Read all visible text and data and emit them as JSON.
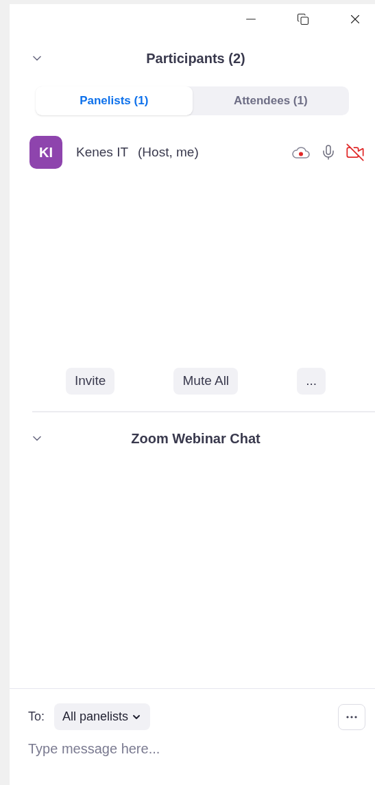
{
  "participants": {
    "title": "Participants (2)",
    "expanded": true,
    "tabs": [
      {
        "label": "Panelists (1)",
        "selected": true
      },
      {
        "label": "Attendees (1)",
        "selected": false
      }
    ],
    "list": [
      {
        "initials": "KI",
        "color": "#8e44ad",
        "name": "Kenes IT",
        "role": "(Host, me)",
        "recording": true,
        "audio_muted": false,
        "video_on": false
      }
    ],
    "buttons": [
      "Invite",
      "Mute All",
      "..."
    ]
  },
  "chat": {
    "title": "Zoom Webinar Chat",
    "expanded": true,
    "to_label": "To:",
    "recipient": "All panelists",
    "placeholder": "Type message here..."
  }
}
